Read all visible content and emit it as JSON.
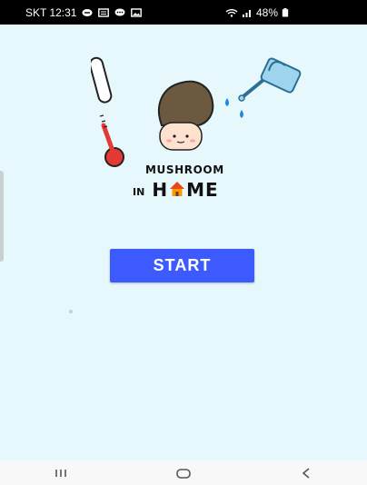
{
  "status_bar": {
    "carrier_time": "SKT 12:31",
    "battery": "48%",
    "icons": [
      "message-icon",
      "mail-icon",
      "chat-icon",
      "image-icon",
      "wifi-icon",
      "signal-icon",
      "battery-icon"
    ]
  },
  "logo": {
    "line1": "MUSHROOM",
    "line2_prefix": "IN",
    "home_h": "H",
    "home_tail": "ME"
  },
  "start_button": {
    "label": "START"
  },
  "colors": {
    "background": "#e6f8fb",
    "button": "#3d5afe",
    "status_bar": "#000000",
    "nav_bar": "#f8f8f8"
  },
  "nav": {
    "icons": [
      "recent-apps-icon",
      "home-icon",
      "back-icon"
    ]
  }
}
